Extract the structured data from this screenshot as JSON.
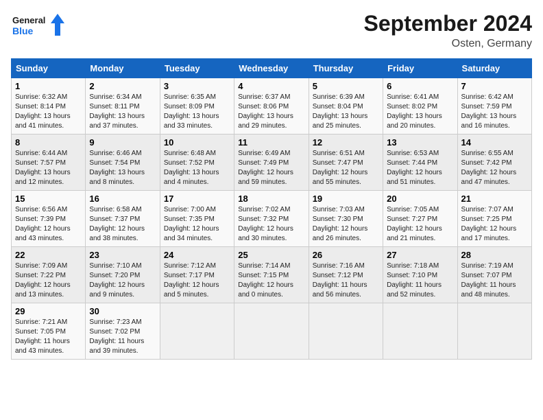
{
  "header": {
    "logo_general": "General",
    "logo_blue": "Blue",
    "month_title": "September 2024",
    "location": "Osten, Germany"
  },
  "days_of_week": [
    "Sunday",
    "Monday",
    "Tuesday",
    "Wednesday",
    "Thursday",
    "Friday",
    "Saturday"
  ],
  "weeks": [
    [
      {
        "day": "1",
        "sunrise": "6:32 AM",
        "sunset": "8:14 PM",
        "daylight": "13 hours and 41 minutes."
      },
      {
        "day": "2",
        "sunrise": "6:34 AM",
        "sunset": "8:11 PM",
        "daylight": "13 hours and 37 minutes."
      },
      {
        "day": "3",
        "sunrise": "6:35 AM",
        "sunset": "8:09 PM",
        "daylight": "13 hours and 33 minutes."
      },
      {
        "day": "4",
        "sunrise": "6:37 AM",
        "sunset": "8:06 PM",
        "daylight": "13 hours and 29 minutes."
      },
      {
        "day": "5",
        "sunrise": "6:39 AM",
        "sunset": "8:04 PM",
        "daylight": "13 hours and 25 minutes."
      },
      {
        "day": "6",
        "sunrise": "6:41 AM",
        "sunset": "8:02 PM",
        "daylight": "13 hours and 20 minutes."
      },
      {
        "day": "7",
        "sunrise": "6:42 AM",
        "sunset": "7:59 PM",
        "daylight": "13 hours and 16 minutes."
      }
    ],
    [
      {
        "day": "8",
        "sunrise": "6:44 AM",
        "sunset": "7:57 PM",
        "daylight": "13 hours and 12 minutes."
      },
      {
        "day": "9",
        "sunrise": "6:46 AM",
        "sunset": "7:54 PM",
        "daylight": "13 hours and 8 minutes."
      },
      {
        "day": "10",
        "sunrise": "6:48 AM",
        "sunset": "7:52 PM",
        "daylight": "13 hours and 4 minutes."
      },
      {
        "day": "11",
        "sunrise": "6:49 AM",
        "sunset": "7:49 PM",
        "daylight": "12 hours and 59 minutes."
      },
      {
        "day": "12",
        "sunrise": "6:51 AM",
        "sunset": "7:47 PM",
        "daylight": "12 hours and 55 minutes."
      },
      {
        "day": "13",
        "sunrise": "6:53 AM",
        "sunset": "7:44 PM",
        "daylight": "12 hours and 51 minutes."
      },
      {
        "day": "14",
        "sunrise": "6:55 AM",
        "sunset": "7:42 PM",
        "daylight": "12 hours and 47 minutes."
      }
    ],
    [
      {
        "day": "15",
        "sunrise": "6:56 AM",
        "sunset": "7:39 PM",
        "daylight": "12 hours and 43 minutes."
      },
      {
        "day": "16",
        "sunrise": "6:58 AM",
        "sunset": "7:37 PM",
        "daylight": "12 hours and 38 minutes."
      },
      {
        "day": "17",
        "sunrise": "7:00 AM",
        "sunset": "7:35 PM",
        "daylight": "12 hours and 34 minutes."
      },
      {
        "day": "18",
        "sunrise": "7:02 AM",
        "sunset": "7:32 PM",
        "daylight": "12 hours and 30 minutes."
      },
      {
        "day": "19",
        "sunrise": "7:03 AM",
        "sunset": "7:30 PM",
        "daylight": "12 hours and 26 minutes."
      },
      {
        "day": "20",
        "sunrise": "7:05 AM",
        "sunset": "7:27 PM",
        "daylight": "12 hours and 21 minutes."
      },
      {
        "day": "21",
        "sunrise": "7:07 AM",
        "sunset": "7:25 PM",
        "daylight": "12 hours and 17 minutes."
      }
    ],
    [
      {
        "day": "22",
        "sunrise": "7:09 AM",
        "sunset": "7:22 PM",
        "daylight": "12 hours and 13 minutes."
      },
      {
        "day": "23",
        "sunrise": "7:10 AM",
        "sunset": "7:20 PM",
        "daylight": "12 hours and 9 minutes."
      },
      {
        "day": "24",
        "sunrise": "7:12 AM",
        "sunset": "7:17 PM",
        "daylight": "12 hours and 5 minutes."
      },
      {
        "day": "25",
        "sunrise": "7:14 AM",
        "sunset": "7:15 PM",
        "daylight": "12 hours and 0 minutes."
      },
      {
        "day": "26",
        "sunrise": "7:16 AM",
        "sunset": "7:12 PM",
        "daylight": "11 hours and 56 minutes."
      },
      {
        "day": "27",
        "sunrise": "7:18 AM",
        "sunset": "7:10 PM",
        "daylight": "11 hours and 52 minutes."
      },
      {
        "day": "28",
        "sunrise": "7:19 AM",
        "sunset": "7:07 PM",
        "daylight": "11 hours and 48 minutes."
      }
    ],
    [
      {
        "day": "29",
        "sunrise": "7:21 AM",
        "sunset": "7:05 PM",
        "daylight": "11 hours and 43 minutes."
      },
      {
        "day": "30",
        "sunrise": "7:23 AM",
        "sunset": "7:02 PM",
        "daylight": "11 hours and 39 minutes."
      },
      null,
      null,
      null,
      null,
      null
    ]
  ],
  "labels": {
    "sunrise": "Sunrise:",
    "sunset": "Sunset:",
    "daylight": "Daylight:"
  }
}
